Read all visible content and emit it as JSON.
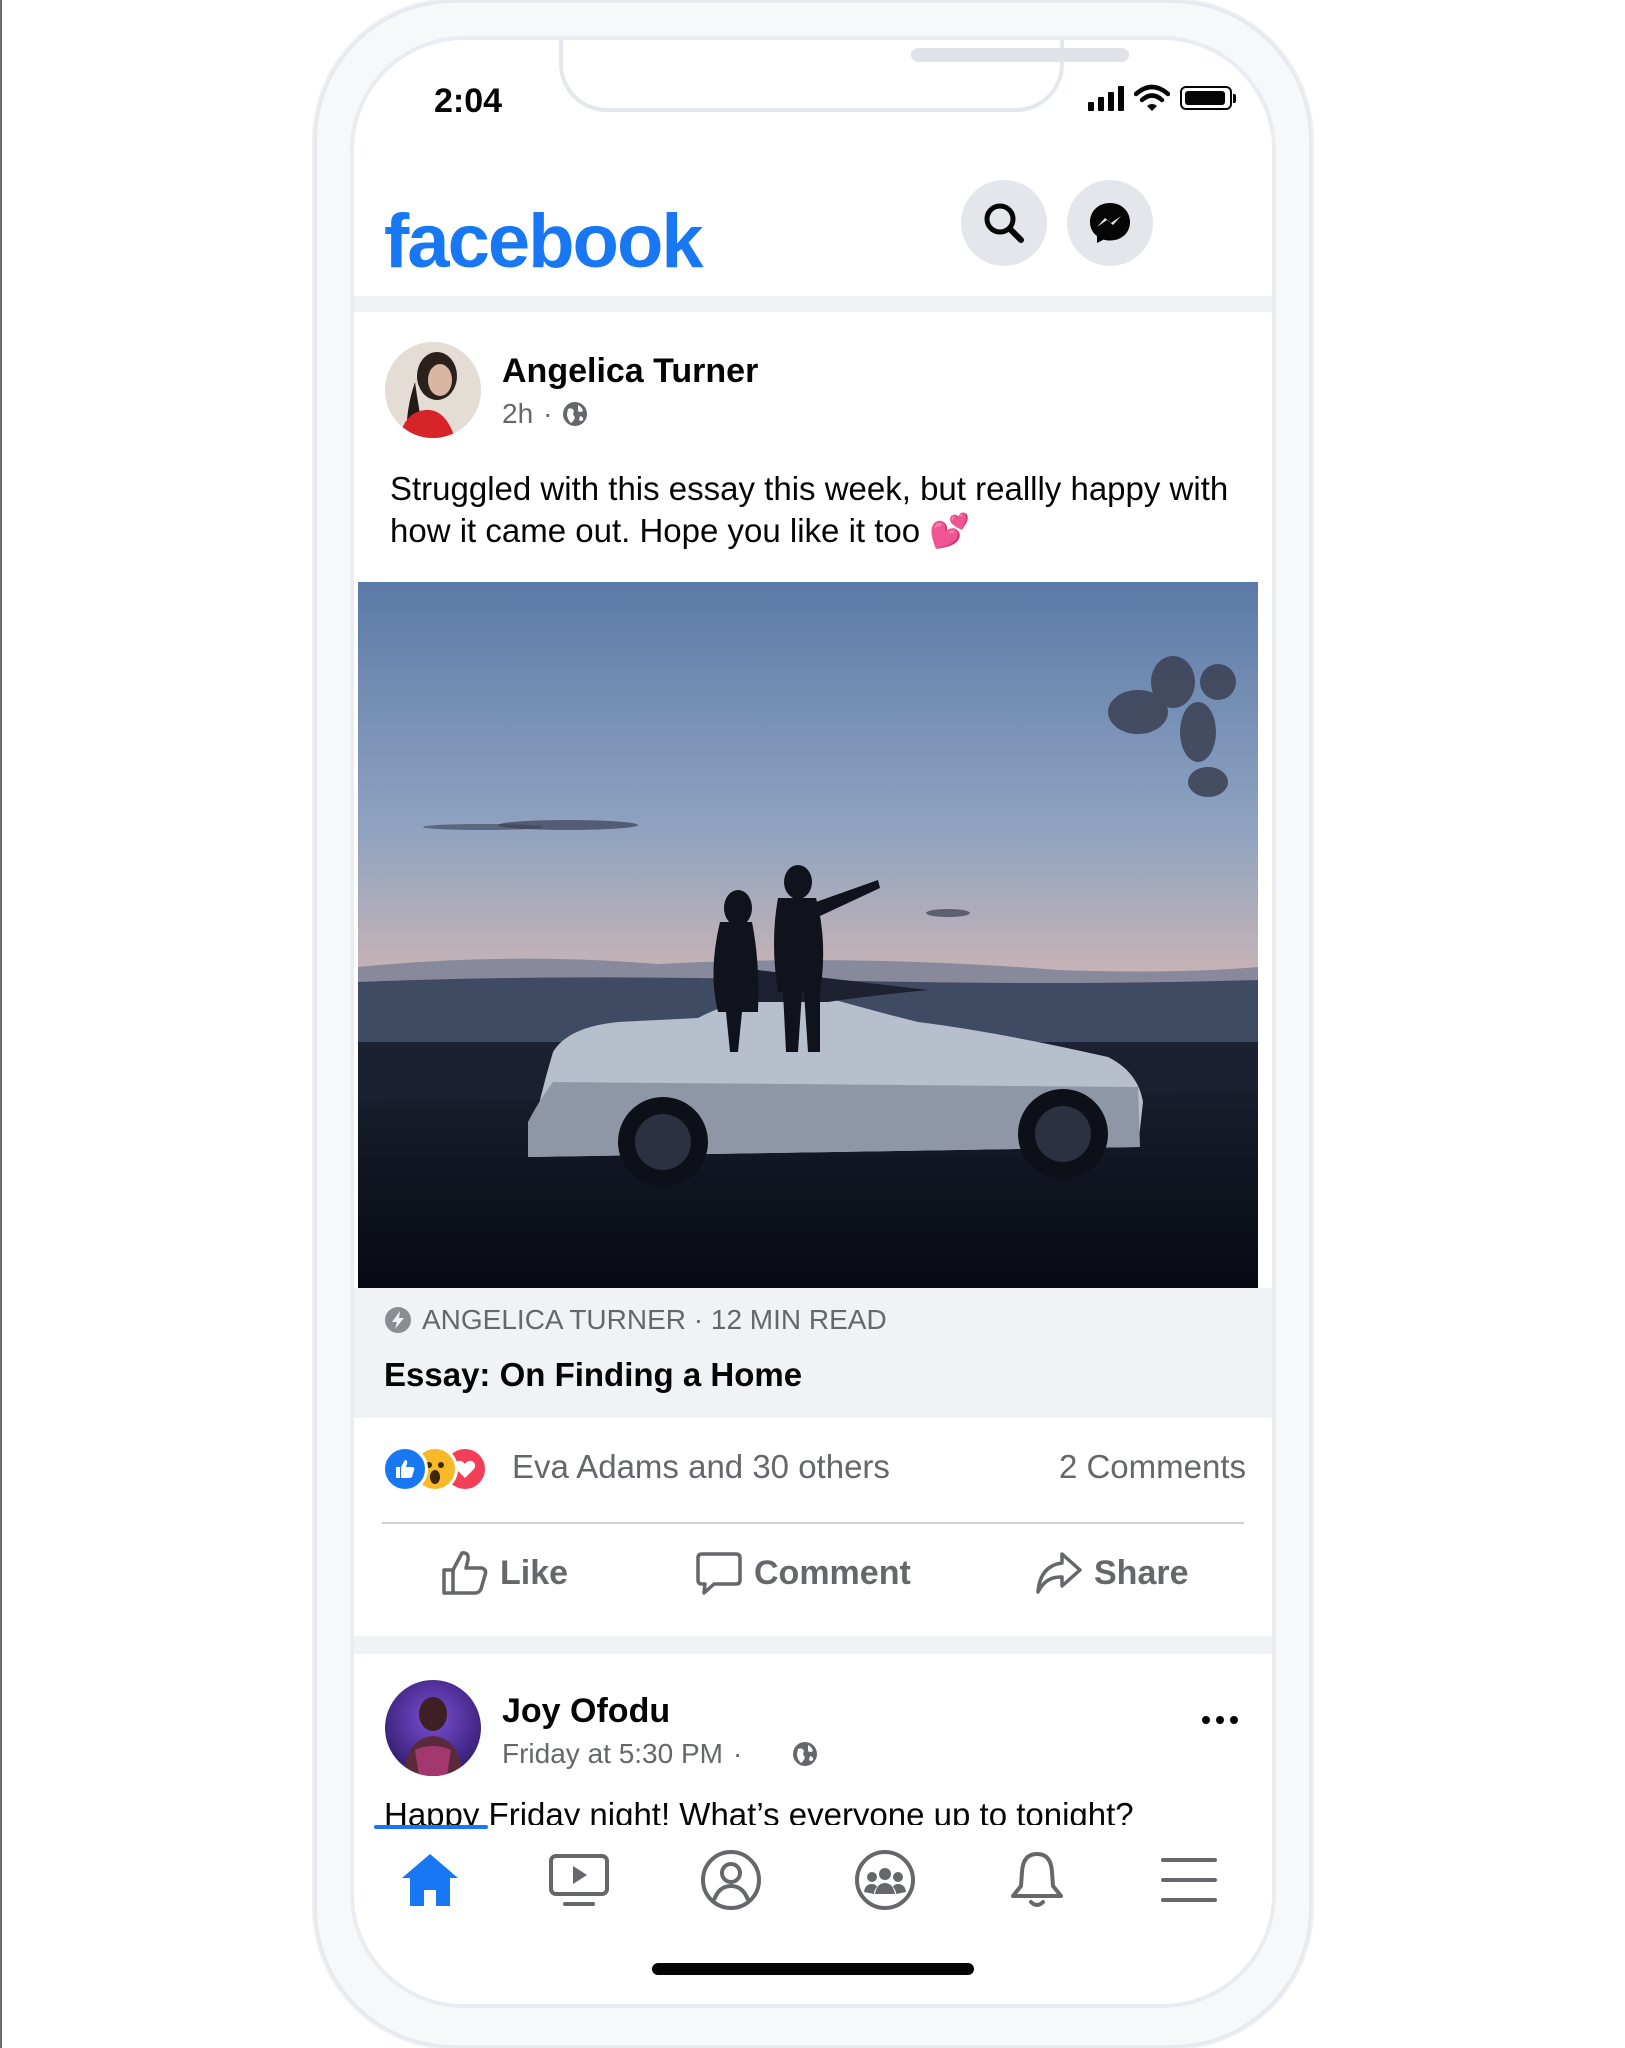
{
  "status_bar": {
    "time": "2:04"
  },
  "header": {
    "logo": "facebook",
    "search_icon": "search-icon",
    "messenger_icon": "messenger-icon"
  },
  "post1": {
    "author": "Angelica Turner",
    "time": "2h",
    "separator": "·",
    "privacy_icon": "globe-icon",
    "text": "Struggled with this essay this week, but reallly happy with how it came out. Hope you like it too 💕",
    "link": {
      "source": "ANGELICA TURNER · 12 MIN READ",
      "title": "Essay: On Finding a Home",
      "source_icon": "instant-article-icon"
    },
    "reactions": {
      "icons": [
        "like-reaction-icon",
        "wow-reaction-icon",
        "love-reaction-icon"
      ],
      "text": "Eva Adams and 30 others",
      "comments": "2 Comments"
    },
    "actions": {
      "like": "Like",
      "comment": "Comment",
      "share": "Share"
    }
  },
  "post2": {
    "author": "Joy Ofodu",
    "time": "Friday at 5:30 PM",
    "separator": "·",
    "privacy_icon": "globe-icon",
    "text": "Happy Friday night! What’s everyone up to tonight?"
  },
  "tabbar": {
    "tabs": [
      "home-icon",
      "watch-icon",
      "profile-icon",
      "groups-icon",
      "notifications-icon",
      "menu-icon"
    ],
    "active": "home-icon",
    "accent": "#1877f2"
  },
  "colors": {
    "brand": "#1877f2",
    "secondary_text": "#65676b",
    "band": "#f0f2f5"
  }
}
